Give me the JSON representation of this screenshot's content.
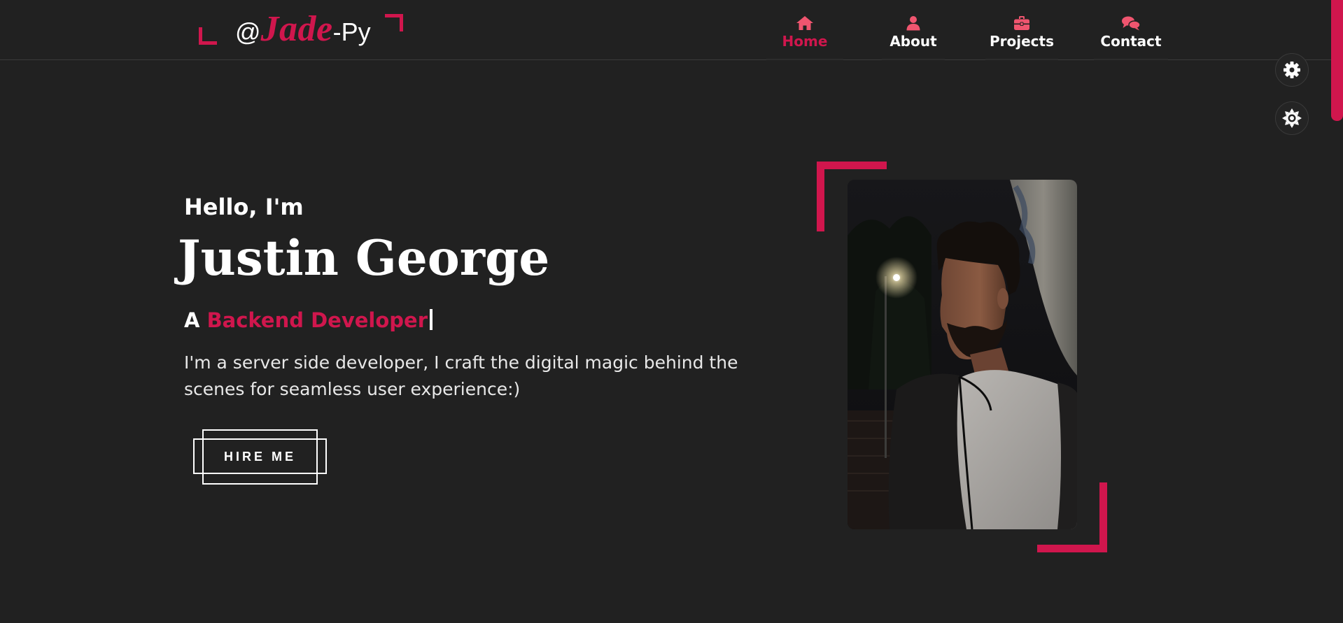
{
  "header": {
    "logo": {
      "prefix": "@",
      "brand": "Jade",
      "suffix": "-Py"
    },
    "nav": [
      {
        "label": "Home",
        "icon": "home-icon",
        "active": true
      },
      {
        "label": "About",
        "icon": "user-icon",
        "active": false
      },
      {
        "label": "Projects",
        "icon": "briefcase-icon",
        "active": false
      },
      {
        "label": "Contact",
        "icon": "chat-bubbles-icon",
        "active": false
      }
    ]
  },
  "side_controls": [
    {
      "icon": "gear-icon"
    },
    {
      "icon": "theme-toggle-icon"
    }
  ],
  "hero": {
    "greeting": "Hello, I'm",
    "name": "Justin George",
    "role_prefix": "A",
    "role_text": "Backend Developer",
    "description": "I'm a server side developer, I craft the digital magic behind the scenes for seamless user experience:)",
    "cta_label": "HIRE ME"
  },
  "colors": {
    "background": "#212121",
    "accent": "#d0164d",
    "nav_icon": "#f0556f",
    "text": "#ffffff"
  }
}
